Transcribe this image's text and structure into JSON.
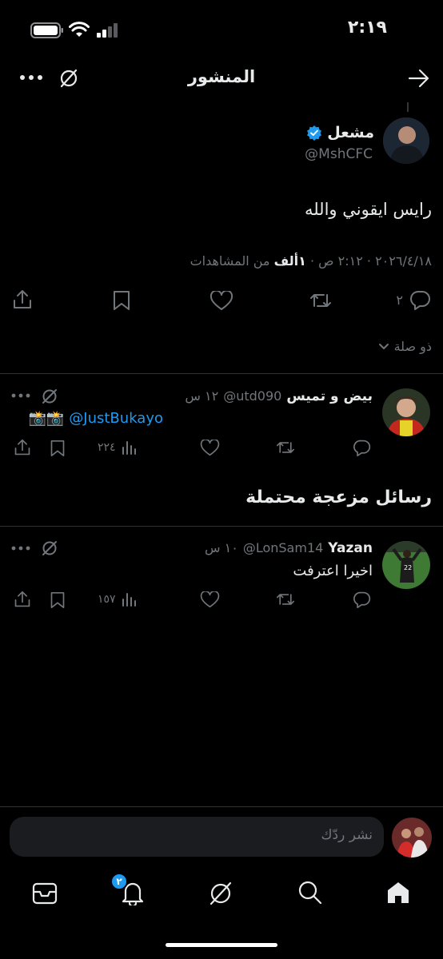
{
  "status_bar": {
    "time": "٢:١٩"
  },
  "header": {
    "title": "المنشور"
  },
  "main_post": {
    "name": "مشعل",
    "handle": "@MshCFC",
    "text": "رايس ايقوني والله",
    "meta_date": "٢٠٢٦/٤/١٨",
    "meta_time": "٢:١٢ ص",
    "meta_sep": "·",
    "views_count": "١ألف",
    "views_label": "من المشاهدات",
    "reply_count": "٢",
    "related_label": "ذو صلة"
  },
  "reply1": {
    "name": "بيض و تميس",
    "handle": "@utd090",
    "time": "١٢ س",
    "mention": "@JustBukayo",
    "emoji": "📸📸",
    "views": "٢٢٤"
  },
  "section_title": "رسائل مزعجة محتملة",
  "reply2": {
    "name": "Yazan",
    "handle": "@LonSam14",
    "time": "١٠ س",
    "text": "اخيرا اعترفت",
    "views": "١٥٧"
  },
  "composer": {
    "placeholder": "نشر ردّك"
  },
  "bottom_nav": {
    "notifications_badge": "٢"
  },
  "colors": {
    "accent": "#1d9bf0",
    "muted": "#71767b",
    "text": "#e7e9ea",
    "divider": "#2f3336"
  }
}
